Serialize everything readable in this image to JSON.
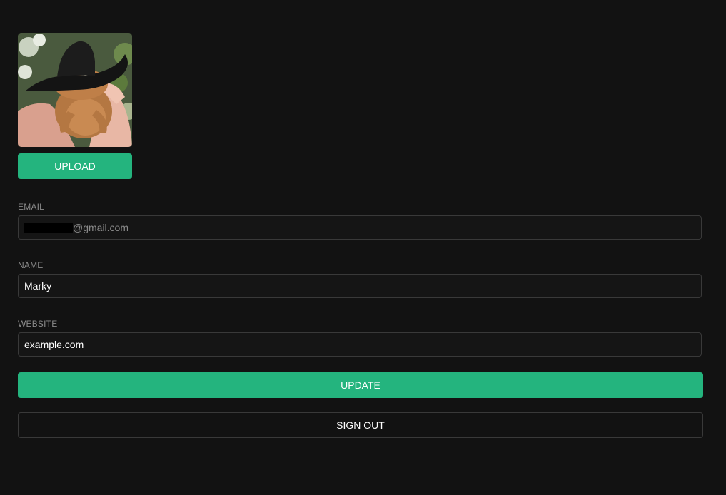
{
  "avatar": {
    "alt": "frog-with-cowboy-hat"
  },
  "upload": {
    "label": "Upload"
  },
  "email": {
    "label": "Email",
    "value_suffix": "@gmail.com"
  },
  "name": {
    "label": "Name",
    "value": "Marky"
  },
  "website": {
    "label": "Website",
    "value": "example.com"
  },
  "actions": {
    "update_label": "Update",
    "signout_label": "Sign Out"
  },
  "colors": {
    "background": "#121212",
    "accent": "#24b47e",
    "border": "#393939",
    "label": "#8a8a8a"
  }
}
